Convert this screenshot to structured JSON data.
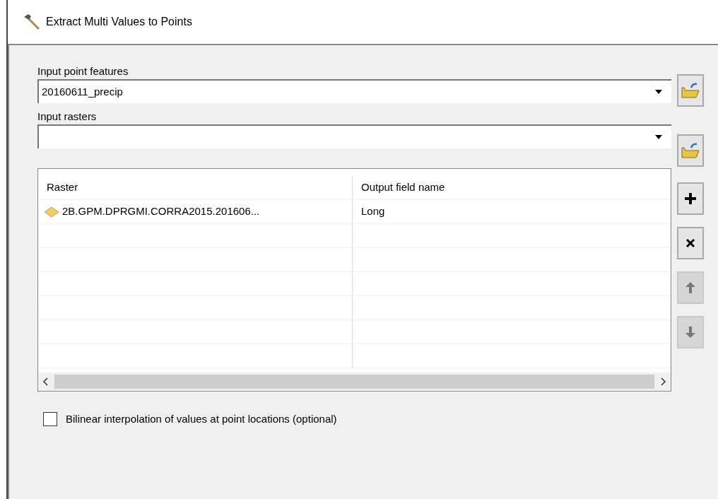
{
  "window": {
    "title": "Extract Multi Values to Points"
  },
  "input_point_features": {
    "label": "Input point features",
    "value": "20160611_precip"
  },
  "input_rasters": {
    "label": "Input rasters"
  },
  "table": {
    "columns": [
      "Raster",
      "Output field name"
    ],
    "rows": [
      {
        "raster": "2B.GPM.DPRGMI.CORRA2015.201606...",
        "output_field_name": "Long"
      }
    ]
  },
  "side_buttons": [
    {
      "kind": "add",
      "disabled": false
    },
    {
      "kind": "remove",
      "disabled": false
    },
    {
      "kind": "up",
      "disabled": true
    },
    {
      "kind": "down",
      "disabled": true
    }
  ],
  "bilinear": {
    "label": "Bilinear interpolation of values at point locations (optional)",
    "checked": false
  }
}
